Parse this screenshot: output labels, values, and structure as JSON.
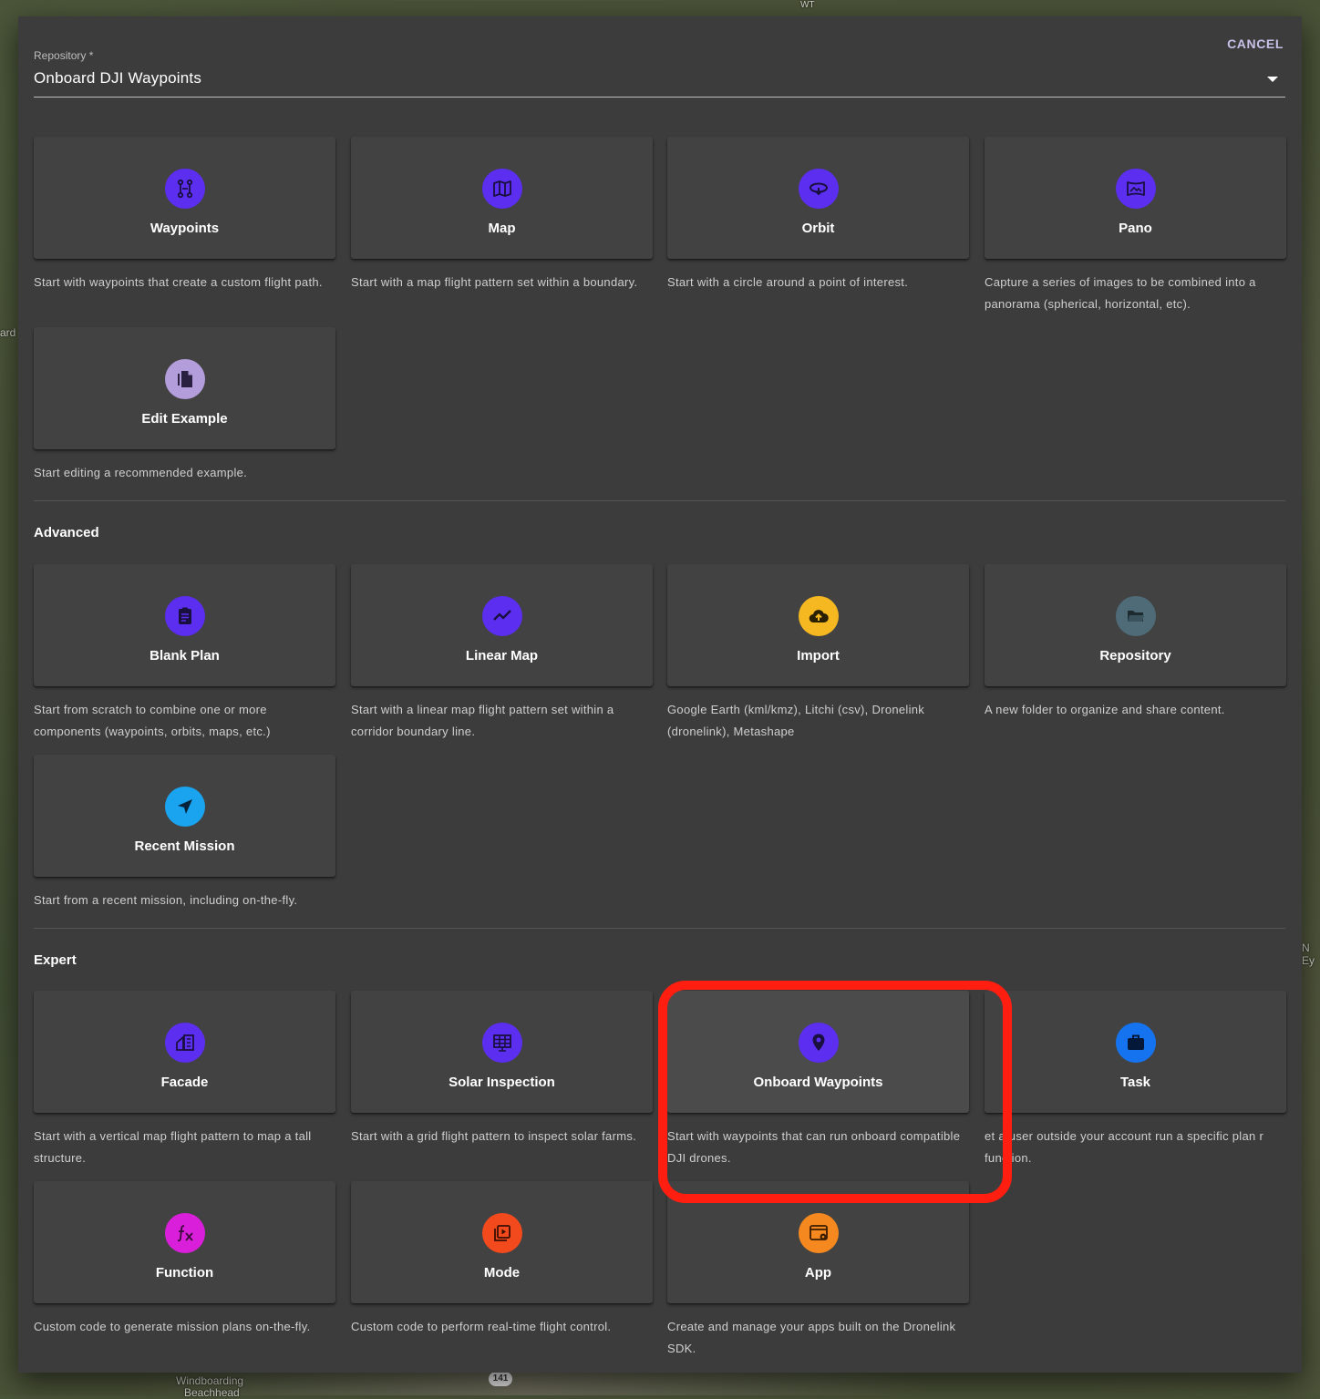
{
  "background_labels": {
    "left_map_text": "ard",
    "right_map_text": "N Ey",
    "top_map_text": "WT",
    "bottom_place_1": "Windboarding",
    "bottom_place_2": "Beachhead",
    "road_shield": "141"
  },
  "dialog": {
    "cancel_label": "CANCEL",
    "repository": {
      "label": "Repository *",
      "value": "Onboard DJI Waypoints"
    },
    "sections": [
      {
        "heading": "",
        "cards": [
          {
            "title": "Waypoints",
            "icon": "waypoints-icon",
            "color": "#5b2ef0",
            "description": "Start with waypoints that create a custom flight path."
          },
          {
            "title": "Map",
            "icon": "map-icon",
            "color": "#5b2ef0",
            "description": "Start with a map flight pattern set within a boundary."
          },
          {
            "title": "Orbit",
            "icon": "orbit-icon",
            "color": "#5b2ef0",
            "description": "Start with a circle around a point of interest."
          },
          {
            "title": "Pano",
            "icon": "panorama-icon",
            "color": "#5b2ef0",
            "description": "Capture a series of images to be combined into a panorama (spherical, horizontal, etc)."
          },
          {
            "title": "Edit Example",
            "icon": "copy-document-icon",
            "color": "#b39ddb",
            "description": "Start editing a recommended example."
          }
        ]
      },
      {
        "heading": "Advanced",
        "cards": [
          {
            "title": "Blank Plan",
            "icon": "clipboard-icon",
            "color": "#5b2ef0",
            "description": "Start from scratch to combine one or more components (waypoints, orbits, maps, etc.)"
          },
          {
            "title": "Linear Map",
            "icon": "trending-line-icon",
            "color": "#5b2ef0",
            "description": "Start with a linear map flight pattern set within a corridor boundary line."
          },
          {
            "title": "Import",
            "icon": "cloud-upload-icon",
            "color": "#f5b820",
            "description": "Google Earth (kml/kmz), Litchi (csv), Dronelink (dronelink), Metashape"
          },
          {
            "title": "Repository",
            "icon": "folder-open-icon",
            "color": "#4f6b78",
            "description": "A new folder to organize and share content."
          },
          {
            "title": "Recent Mission",
            "icon": "navigation-arrow-icon",
            "color": "#1aa4ef",
            "description": "Start from a recent mission, including on-the-fly."
          }
        ]
      },
      {
        "heading": "Expert",
        "cards": [
          {
            "title": "Facade",
            "icon": "building-icon",
            "color": "#5b2ef0",
            "description": "Start with a vertical map flight pattern to map a tall structure."
          },
          {
            "title": "Solar Inspection",
            "icon": "solar-panel-icon",
            "color": "#5b2ef0",
            "description": "Start with a grid flight pattern to inspect solar farms."
          },
          {
            "title": "Onboard Waypoints",
            "icon": "location-pin-icon",
            "color": "#5b2ef0",
            "description": "Start with waypoints that can run onboard compatible DJI drones."
          },
          {
            "title": "Task",
            "icon": "briefcase-icon",
            "color": "#1673f0",
            "description": "et a user outside your account run a specific plan r function."
          },
          {
            "title": "Function",
            "icon": "function-fx-icon",
            "color": "#d91fd9",
            "description": "Custom code to generate mission plans on-the-fly."
          },
          {
            "title": "Mode",
            "icon": "video-library-icon",
            "color": "#f24a1d",
            "description": "Custom code to perform real-time flight control."
          },
          {
            "title": "App",
            "icon": "app-settings-icon",
            "color": "#f5891f",
            "description": "Create and manage your apps built on the Dronelink SDK."
          }
        ]
      }
    ]
  }
}
